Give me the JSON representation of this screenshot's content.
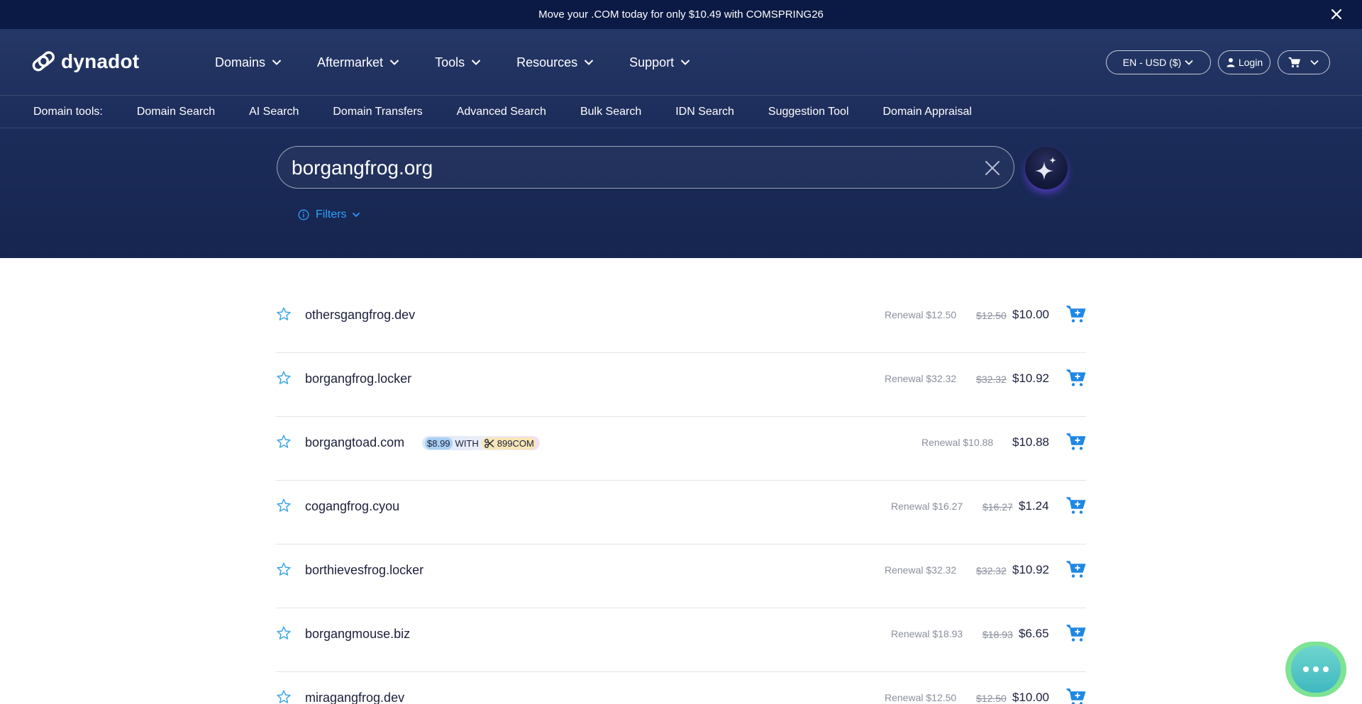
{
  "promo": {
    "text": "Move your .COM today for only $10.49 with COMSPRING26"
  },
  "brand": {
    "name": "dynadot"
  },
  "nav": {
    "items": [
      {
        "label": "Domains"
      },
      {
        "label": "Aftermarket"
      },
      {
        "label": "Tools"
      },
      {
        "label": "Resources"
      },
      {
        "label": "Support"
      }
    ],
    "language": "EN - USD ($)",
    "login": "Login"
  },
  "tools": {
    "label": "Domain tools:",
    "links": [
      "Domain Search",
      "AI Search",
      "Domain Transfers",
      "Advanced Search",
      "Bulk Search",
      "IDN Search",
      "Suggestion Tool",
      "Domain Appraisal"
    ]
  },
  "search": {
    "value": "borgangfrog.org"
  },
  "filters": {
    "label": "Filters"
  },
  "results": [
    {
      "domain": "othersgangfrog.dev",
      "renewal": "Renewal $12.50",
      "old_price": "$12.50",
      "price": "$10.00"
    },
    {
      "domain": "borgangfrog.locker",
      "renewal": "Renewal $32.32",
      "old_price": "$32.32",
      "price": "$10.92"
    },
    {
      "domain": "borgangtoad.com",
      "renewal": "Renewal $10.88",
      "old_price": "",
      "price": "$10.88",
      "promo": {
        "price": "$8.99",
        "with": "WITH",
        "code": "899COM"
      }
    },
    {
      "domain": "cogangfrog.cyou",
      "renewal": "Renewal $16.27",
      "old_price": "$16.27",
      "price": "$1.24"
    },
    {
      "domain": "borthievesfrog.locker",
      "renewal": "Renewal $32.32",
      "old_price": "$32.32",
      "price": "$10.92"
    },
    {
      "domain": "borgangmouse.biz",
      "renewal": "Renewal $18.93",
      "old_price": "$18.93",
      "price": "$6.65"
    },
    {
      "domain": "miragangfrog.dev",
      "renewal": "Renewal $12.50",
      "old_price": "$12.50",
      "price": "$10.00"
    }
  ],
  "colors": {
    "hero": "#1c2c5a",
    "promo_bar": "#0b1a45",
    "accent": "#1e88e5",
    "link": "#2ea0ff",
    "chat": "#7ee393"
  },
  "icons": {
    "promo_close": "close-icon",
    "menu_chevron": "chevron-down-icon",
    "login": "user-icon",
    "cart": "cart-icon",
    "search_clear": "close-icon",
    "ai": "sparkle-icon",
    "filters": "info-icon",
    "favorite": "star-icon",
    "add_to_cart": "add-to-cart-icon",
    "coupon": "scissors-icon",
    "chat": "chat-bubble-icon"
  }
}
